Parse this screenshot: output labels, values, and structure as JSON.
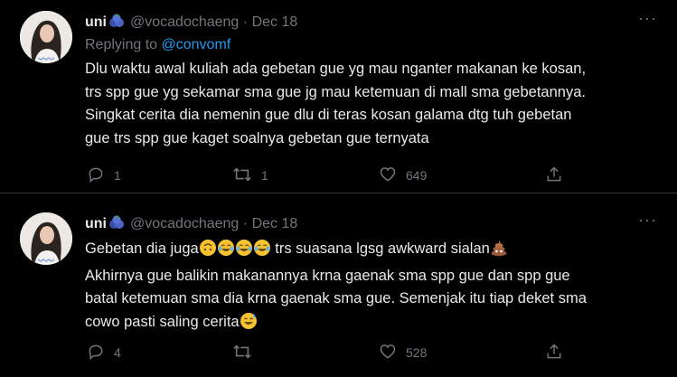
{
  "tweets": [
    {
      "name": "uni",
      "handle": "@vocadochaeng",
      "separator": "·",
      "date": "Dec 18",
      "replying_prefix": "Replying to ",
      "replying_handle": "@convomf",
      "lines": [
        "Dlu waktu awal kuliah ada gebetan gue yg mau nganter makanan ke kosan,",
        "trs spp gue yg sekamar sma gue jg mau ketemuan di mall sma gebetannya.",
        "Singkat cerita dia nemenin gue dlu di teras kosan galama dtg tuh gebetan",
        "gue trs spp gue kaget soalnya gebetan gue ternyata"
      ],
      "replies": "1",
      "retweets": "1",
      "likes": "649",
      "more_label": "···"
    },
    {
      "name": "uni",
      "handle": "@vocadochaeng",
      "separator": "·",
      "date": "Dec 18",
      "line1_text_a": "Gebetan dia juga",
      "line1_text_b": " trs suasana lgsg awkward sialan",
      "lines": [
        "Akhirnya gue balikin makanannya krna gaenak sma spp gue dan spp gue",
        "batal ketemuan sma dia krna gaenak sma gue. Semenjak itu tiap deket sma"
      ],
      "last_line_text": "cowo pasti saling cerita",
      "replies": "4",
      "retweets": "",
      "likes": "528",
      "more_label": "···"
    }
  ],
  "icons": {
    "reply": "reply-icon",
    "retweet": "retweet-icon",
    "like": "heart-icon",
    "share": "share-icon",
    "badge": "blueberry-emoji-icon"
  },
  "colors": {
    "background": "#000000",
    "text": "#e7e9ea",
    "muted": "#71767b",
    "link": "#1d9bf0",
    "divider": "#2f3336"
  }
}
